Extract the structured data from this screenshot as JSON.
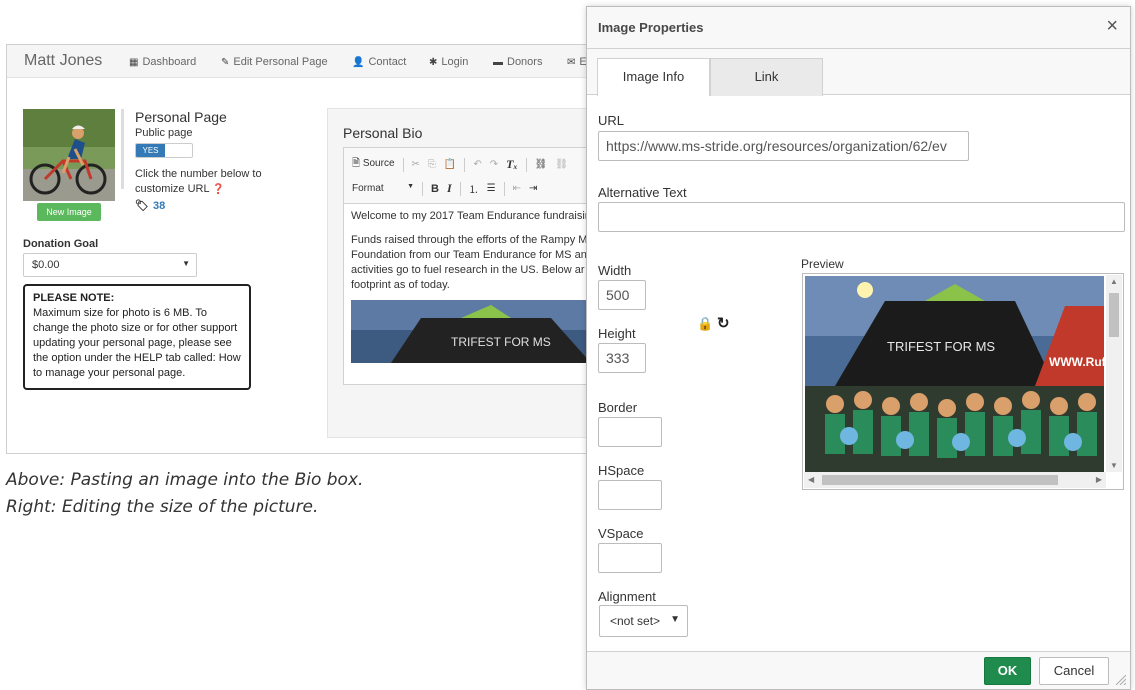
{
  "background_page": {
    "brand": "Matt Jones",
    "nav": [
      {
        "icon": "▦",
        "icon_name": "grid-icon",
        "label": "Dashboard"
      },
      {
        "icon": "✎",
        "icon_name": "pencil-icon",
        "label": "Edit Personal Page"
      },
      {
        "icon": "👤",
        "icon_name": "user-icon",
        "label": "Contact"
      },
      {
        "icon": "✱",
        "icon_name": "asterisk-icon",
        "label": "Login"
      },
      {
        "icon": "▬",
        "icon_name": "briefcase-icon",
        "label": "Donors"
      },
      {
        "icon": "✉",
        "icon_name": "envelope-icon",
        "label": "E"
      }
    ],
    "new_image_label": "New Image",
    "personal_page": {
      "title": "Personal Page",
      "subtitle": "Public page",
      "toggle_label": "YES",
      "hint": "Click the number below to customize URL",
      "number": "38"
    },
    "donation_goal": {
      "label": "Donation Goal",
      "value": "$0.00"
    },
    "note": {
      "title": "PLEASE NOTE:",
      "body": "Maximum size for photo is 6 MB. To change the photo size or for other support updating your personal page, please see the option under the HELP tab called: How to manage your personal page."
    },
    "bio": {
      "title": "Personal Bio",
      "source_label": "Source",
      "format_label": "Format",
      "paragraph_1": "Welcome to my 2017 Team Endurance fundraisir",
      "paragraph_2_lines": [
        "Funds raised through the efforts of the Rampy M",
        "Foundation from our Team Endurance for MS an",
        "activities go to fuel research in the US.  Below ar",
        "footprint as of today."
      ],
      "banner_text": "TRIFEST FOR MS"
    }
  },
  "captions": {
    "above": "Above: Pasting an image into the Bio box.",
    "right": "Right: Editing the size of the picture."
  },
  "dialog": {
    "title": "Image Properties",
    "close": "×",
    "tabs": [
      {
        "label": "Image Info",
        "active": true
      },
      {
        "label": "Link",
        "active": false
      }
    ],
    "url_label": "URL",
    "url_value": "https://www.ms-stride.org/resources/organization/62/ev",
    "alt_label": "Alternative Text",
    "alt_value": "",
    "width_label": "Width",
    "width_value": "500",
    "height_label": "Height",
    "height_value": "333",
    "border_label": "Border",
    "hspace_label": "HSpace",
    "vspace_label": "VSpace",
    "alignment_label": "Alignment",
    "alignment_value": "<not set>",
    "preview_label": "Preview",
    "preview_banner_1": "TRIFEST FOR MS",
    "preview_banner_2": "WWW.Rufu",
    "ok_label": "OK",
    "cancel_label": "Cancel"
  },
  "colors": {
    "ok_button": "#1f8b4d",
    "new_image_button": "#5cb85c",
    "toggle_on": "#337ab7"
  }
}
